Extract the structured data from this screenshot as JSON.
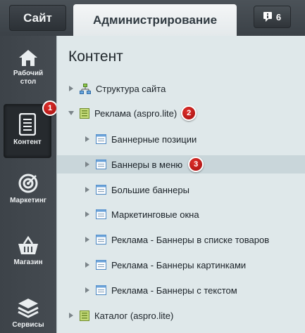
{
  "topbar": {
    "tab_site": "Сайт",
    "tab_admin": "Администрирование",
    "notifications_count": "6",
    "notifications_icon": "info-icon"
  },
  "sidebar": {
    "items": [
      {
        "label_line1": "Рабочий",
        "label_line2": "стол",
        "icon": "home-icon"
      },
      {
        "label": "Контент",
        "icon": "document-icon",
        "active": true,
        "badge": "1"
      },
      {
        "label": "Маркетинг",
        "icon": "target-icon"
      },
      {
        "label": "Магазин",
        "icon": "basket-icon"
      },
      {
        "label": "Сервисы",
        "icon": "layers-icon"
      }
    ]
  },
  "main": {
    "title": "Контент",
    "tree": [
      {
        "label": "Структура сайта",
        "icon": "sitemap-icon",
        "level": 0,
        "expanded": false
      },
      {
        "label": "Реклама (aspro.lite)",
        "icon": "folder-icon",
        "level": 0,
        "expanded": true,
        "badge": "2"
      },
      {
        "label": "Баннерные позиции",
        "icon": "list-icon",
        "level": 1
      },
      {
        "label": "Баннеры в меню",
        "icon": "list-icon",
        "level": 1,
        "highlighted": true,
        "badge": "3"
      },
      {
        "label": "Большие баннеры",
        "icon": "list-icon",
        "level": 1
      },
      {
        "label": "Маркетинговые окна",
        "icon": "list-icon",
        "level": 1
      },
      {
        "label": "Реклама - Баннеры в списке товаров",
        "icon": "list-icon",
        "level": 1
      },
      {
        "label": "Реклама - Баннеры картинками",
        "icon": "list-icon",
        "level": 1
      },
      {
        "label": "Реклама - Баннеры с текстом",
        "icon": "list-icon",
        "level": 1
      },
      {
        "label": "Каталог (aspro.lite)",
        "icon": "folder-icon",
        "level": 0,
        "expanded": false
      }
    ]
  },
  "colors": {
    "badge_red": "#c41a17",
    "highlight_row": "#c9d6da",
    "sidebar_bg": "#3d4349"
  }
}
